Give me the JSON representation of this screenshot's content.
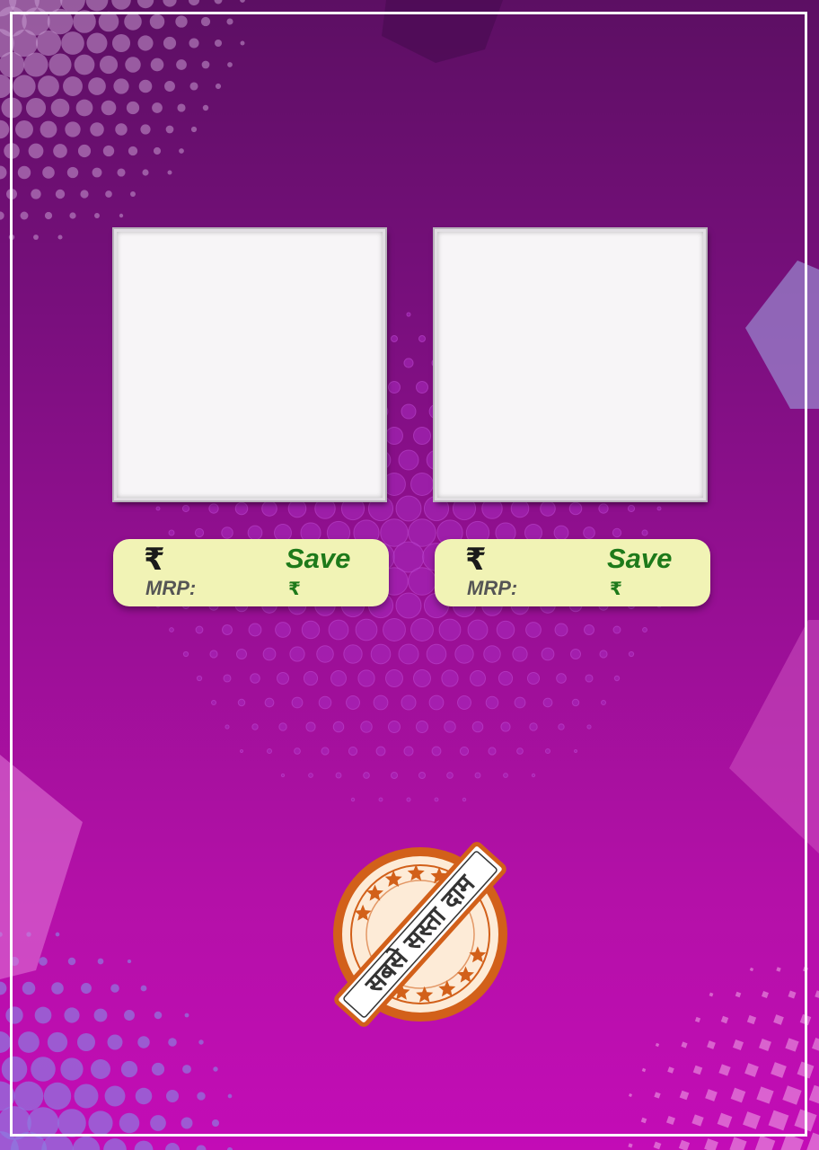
{
  "colors": {
    "background_top": "#5c0f63",
    "background_bottom": "#c30cb6",
    "pill_background": "#f1f3b5",
    "save_green": "#1e7a1a",
    "stamp_orange": "#d2601a"
  },
  "products": [
    {
      "currency_symbol": "₹",
      "mrp_label": "MRP:",
      "save_label": "Save",
      "save_currency": "₹"
    },
    {
      "currency_symbol": "₹",
      "mrp_label": "MRP:",
      "save_label": "Save",
      "save_currency": "₹"
    }
  ],
  "stamp": {
    "text": "सबसे सस्ता दाम",
    "icon": "star-icon"
  }
}
